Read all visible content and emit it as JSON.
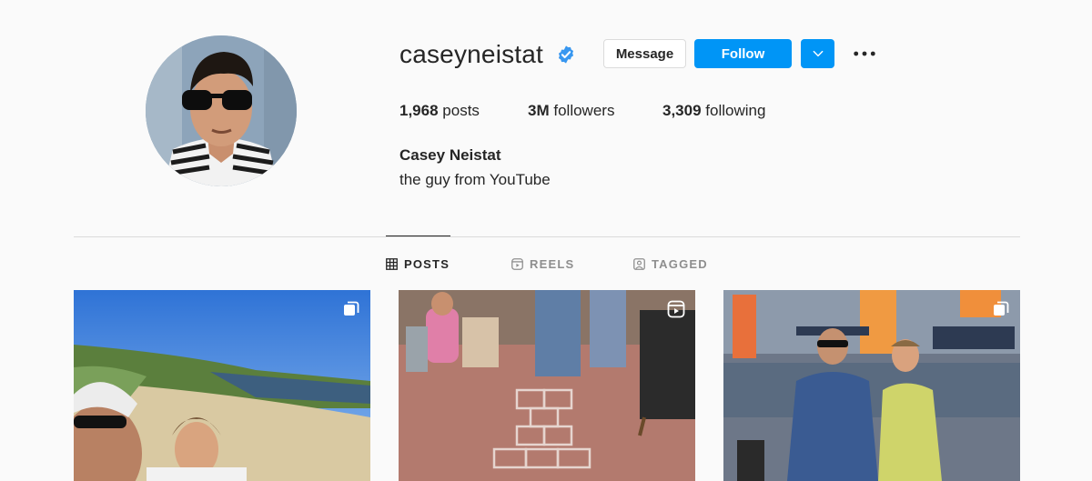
{
  "profile": {
    "username": "caseyneistat",
    "verified": true,
    "full_name": "Casey Neistat",
    "bio": "the guy from YouTube",
    "avatar_icon": "profile-photo"
  },
  "actions": {
    "message_label": "Message",
    "follow_label": "Follow",
    "dropdown_icon": "chevron-down-icon",
    "more_icon": "ellipsis-icon"
  },
  "stats": {
    "posts_count": "1,968",
    "posts_label": "posts",
    "followers_count": "3M",
    "followers_label": "followers",
    "following_count": "3,309",
    "following_label": "following"
  },
  "tabs": [
    {
      "label": "POSTS",
      "icon": "grid-icon",
      "active": true
    },
    {
      "label": "REELS",
      "icon": "reels-icon",
      "active": false
    },
    {
      "label": "TAGGED",
      "icon": "tagged-icon",
      "active": false
    }
  ],
  "posts": [
    {
      "type": "carousel",
      "badge_icon": "carousel-icon",
      "scene": "beach selfie"
    },
    {
      "type": "reel",
      "badge_icon": "reel-icon",
      "scene": "hopscotch street"
    },
    {
      "type": "carousel",
      "badge_icon": "carousel-icon",
      "scene": "airport check-in"
    }
  ],
  "colors": {
    "accent": "#0095f6",
    "text": "#262626",
    "muted": "#8e8e8e",
    "border": "#dbdbdb",
    "background": "#fafafa",
    "verified_badge": "#3897f0"
  }
}
